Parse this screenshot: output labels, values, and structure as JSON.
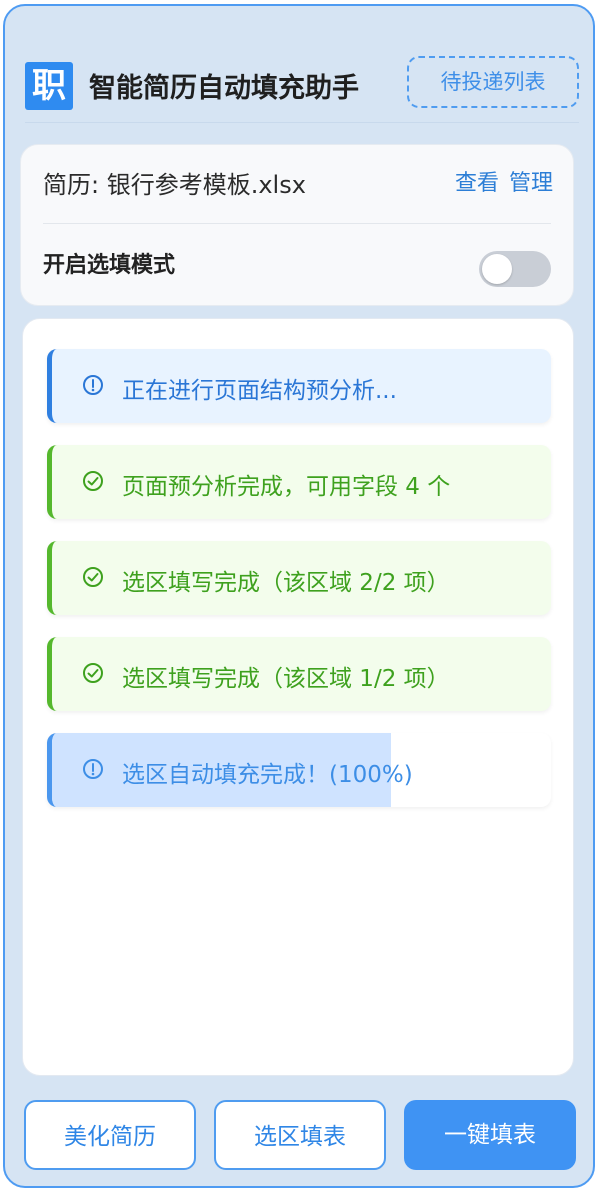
{
  "header": {
    "logo_text": "职",
    "title": "智能简历自动填充助手",
    "pending_button": "待投递列表"
  },
  "resume": {
    "label": "简历: 银行参考模板.xlsx",
    "view_link": "查看",
    "manage_link": "管理",
    "mode_label": "开启选填模式",
    "mode_enabled": false
  },
  "logs": [
    {
      "type": "info",
      "text": "正在进行页面结构预分析..."
    },
    {
      "type": "success",
      "text": "页面预分析完成，可用字段 4 个"
    },
    {
      "type": "success",
      "text": "选区填写完成（该区域 2/2 项）"
    },
    {
      "type": "success",
      "text": "选区填写完成（该区域 1/2 项）"
    },
    {
      "type": "progress",
      "text": "选区自动填充完成！(100%)",
      "fill_fraction": 0.68
    }
  ],
  "buttons": {
    "beautify": "美化简历",
    "select_fill": "选区填表",
    "one_click_fill": "一键填表"
  },
  "colors": {
    "accent": "#3f93f3",
    "info": "#2f7fe0",
    "success": "#55b82d"
  }
}
